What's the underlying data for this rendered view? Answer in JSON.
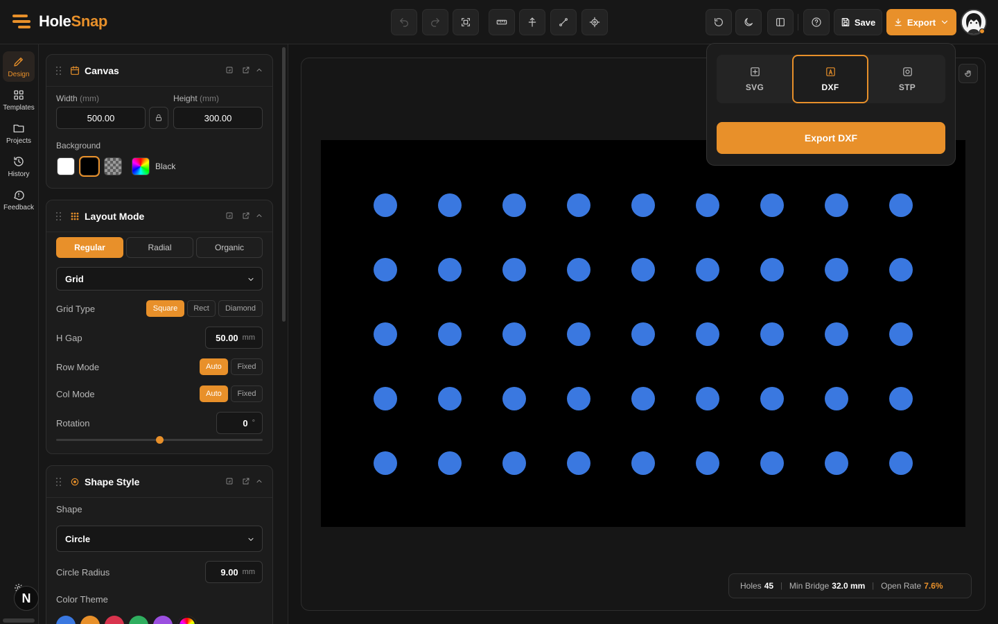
{
  "app": {
    "name_a": "Hole",
    "name_b": "Snap"
  },
  "toolbar": {
    "save_label": "Save",
    "export_label": "Export"
  },
  "rail": [
    {
      "id": "design",
      "label": "Design",
      "icon": "pen-icon",
      "active": true
    },
    {
      "id": "templates",
      "label": "Templates",
      "icon": "grid-icon",
      "active": false
    },
    {
      "id": "projects",
      "label": "Projects",
      "icon": "folder-icon",
      "active": false
    },
    {
      "id": "history",
      "label": "History",
      "icon": "history-icon",
      "active": false
    },
    {
      "id": "feedback",
      "label": "Feedback",
      "icon": "chat-icon",
      "active": false
    }
  ],
  "rail_bottom": {
    "settings_label": "Se",
    "badge": "N"
  },
  "canvas_panel": {
    "title": "Canvas",
    "width_label": "Width",
    "height_label": "Height",
    "unit_label": "(mm)",
    "width_value": "500.00",
    "height_value": "300.00",
    "background_label": "Background",
    "background_name": "Black"
  },
  "layout_panel": {
    "title": "Layout Mode",
    "modes": [
      "Regular",
      "Radial",
      "Organic"
    ],
    "active_mode": "Regular",
    "layout_select": "Grid",
    "grid_type_label": "Grid Type",
    "grid_types": [
      "Square",
      "Rect",
      "Diamond"
    ],
    "active_grid_type": "Square",
    "hgap_label": "H Gap",
    "hgap_value": "50.00",
    "hgap_unit": "mm",
    "row_mode_label": "Row Mode",
    "col_mode_label": "Col Mode",
    "mode_options": [
      "Auto",
      "Fixed"
    ],
    "row_mode": "Auto",
    "col_mode": "Auto",
    "rotation_label": "Rotation",
    "rotation_value": "0",
    "rotation_unit": "°",
    "rotation_slider_fraction": 0.5
  },
  "shape_panel": {
    "title": "Shape Style",
    "shape_label": "Shape",
    "shape_value": "Circle",
    "radius_label": "Circle Radius",
    "radius_value": "9.00",
    "radius_unit": "mm",
    "color_theme_label": "Color Theme"
  },
  "colors": {
    "accent": "#e8902a",
    "hole": "#3a78e0",
    "canvas_bg": "#000000",
    "themes": [
      "#3a78e0",
      "#e8902a",
      "#d9344d",
      "#2fae5f",
      "#9b4fe0",
      "rainbow"
    ]
  },
  "export_menu": {
    "formats": [
      {
        "label": "SVG",
        "icon": "plus-square-icon"
      },
      {
        "label": "DXF",
        "icon": "dxf-icon"
      },
      {
        "label": "STP",
        "icon": "stp-icon"
      }
    ],
    "active_format": "DXF",
    "cta_label": "Export DXF"
  },
  "stats": {
    "holes_label": "Holes",
    "holes_value": "45",
    "bridge_label": "Min Bridge",
    "bridge_value": "32.0 mm",
    "open_label": "Open Rate",
    "open_value": "7.6%"
  },
  "grid": {
    "rows": 5,
    "cols": 9
  }
}
